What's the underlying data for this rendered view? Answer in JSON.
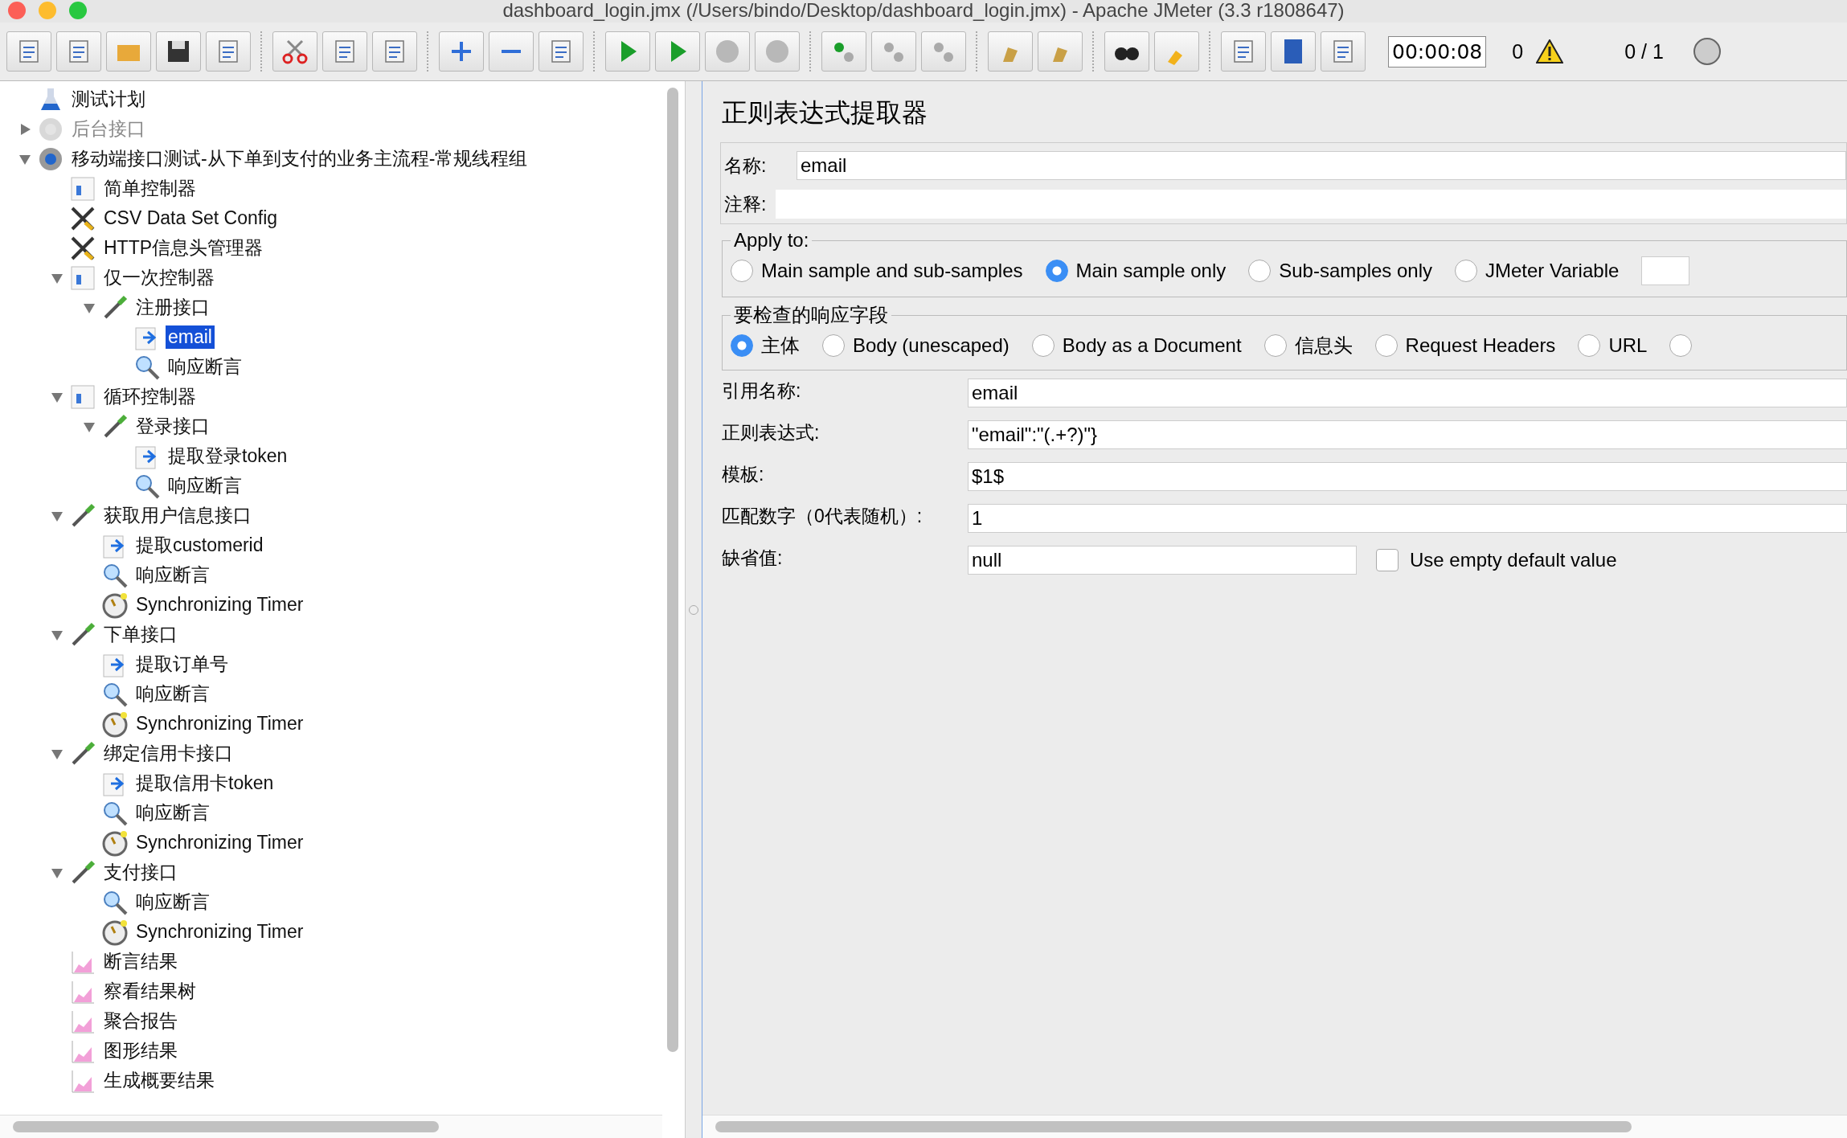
{
  "window": {
    "title": "dashboard_login.jmx (/Users/bindo/Desktop/dashboard_login.jmx) - Apache JMeter (3.3 r1808647)"
  },
  "toolbar": {
    "elapsed": "00:00:08",
    "error_count": "0",
    "threads": "0 / 1"
  },
  "tree": [
    {
      "label": "测试计划",
      "kind": "plan",
      "selected": false,
      "disabled": false
    },
    {
      "label": "后台接口",
      "kind": "thread",
      "selected": false,
      "disabled": true,
      "expanded": false
    },
    {
      "label": "移动端接口测试-从下单到支付的业务主流程-常规线程组",
      "kind": "thread",
      "selected": false,
      "disabled": false,
      "expanded": true,
      "children": [
        {
          "label": "简单控制器",
          "kind": "controller",
          "selected": false,
          "disabled": false
        },
        {
          "label": "CSV Data Set Config",
          "kind": "config",
          "selected": false,
          "disabled": false
        },
        {
          "label": "HTTP信息头管理器",
          "kind": "config",
          "selected": false,
          "disabled": false
        },
        {
          "label": "仅一次控制器",
          "kind": "controller",
          "selected": false,
          "disabled": false,
          "expanded": true,
          "children": [
            {
              "label": "注册接口",
              "kind": "sampler",
              "selected": false,
              "disabled": false,
              "expanded": true,
              "children": [
                {
                  "label": "email",
                  "kind": "extractor",
                  "selected": true,
                  "disabled": false
                },
                {
                  "label": "响应断言",
                  "kind": "assertion",
                  "selected": false,
                  "disabled": false
                }
              ]
            }
          ]
        },
        {
          "label": "循环控制器",
          "kind": "controller",
          "selected": false,
          "disabled": false,
          "expanded": true,
          "children": [
            {
              "label": "登录接口",
              "kind": "sampler",
              "selected": false,
              "disabled": false,
              "expanded": true,
              "children": [
                {
                  "label": "提取登录token",
                  "kind": "extractor",
                  "selected": false,
                  "disabled": false
                },
                {
                  "label": "响应断言",
                  "kind": "assertion",
                  "selected": false,
                  "disabled": false
                }
              ]
            }
          ]
        },
        {
          "label": "获取用户信息接口",
          "kind": "sampler",
          "selected": false,
          "disabled": false,
          "expanded": true,
          "children": [
            {
              "label": "提取customerid",
              "kind": "extractor",
              "selected": false,
              "disabled": false
            },
            {
              "label": "响应断言",
              "kind": "assertion",
              "selected": false,
              "disabled": false
            },
            {
              "label": "Synchronizing Timer",
              "kind": "timer",
              "selected": false,
              "disabled": false
            }
          ]
        },
        {
          "label": "下单接口",
          "kind": "sampler",
          "selected": false,
          "disabled": false,
          "expanded": true,
          "children": [
            {
              "label": "提取订单号",
              "kind": "extractor",
              "selected": false,
              "disabled": false
            },
            {
              "label": "响应断言",
              "kind": "assertion",
              "selected": false,
              "disabled": false
            },
            {
              "label": "Synchronizing Timer",
              "kind": "timer",
              "selected": false,
              "disabled": false
            }
          ]
        },
        {
          "label": "绑定信用卡接口",
          "kind": "sampler",
          "selected": false,
          "disabled": false,
          "expanded": true,
          "children": [
            {
              "label": "提取信用卡token",
              "kind": "extractor",
              "selected": false,
              "disabled": false
            },
            {
              "label": "响应断言",
              "kind": "assertion",
              "selected": false,
              "disabled": false
            },
            {
              "label": "Synchronizing Timer",
              "kind": "timer",
              "selected": false,
              "disabled": false
            }
          ]
        },
        {
          "label": "支付接口",
          "kind": "sampler",
          "selected": false,
          "disabled": false,
          "expanded": true,
          "children": [
            {
              "label": "响应断言",
              "kind": "assertion",
              "selected": false,
              "disabled": false
            },
            {
              "label": "Synchronizing Timer",
              "kind": "timer",
              "selected": false,
              "disabled": false
            }
          ]
        },
        {
          "label": "断言结果",
          "kind": "listener",
          "selected": false,
          "disabled": false
        },
        {
          "label": "察看结果树",
          "kind": "listener",
          "selected": false,
          "disabled": false
        },
        {
          "label": "聚合报告",
          "kind": "listener",
          "selected": false,
          "disabled": false
        },
        {
          "label": "图形结果",
          "kind": "listener",
          "selected": false,
          "disabled": false
        },
        {
          "label": "生成概要结果",
          "kind": "listener",
          "selected": false,
          "disabled": false
        }
      ]
    }
  ],
  "editor": {
    "title": "正则表达式提取器",
    "name": {
      "label": "名称:",
      "value": "email"
    },
    "comment": {
      "label": "注释:"
    },
    "apply_to": {
      "legend": "Apply to:",
      "options": [
        {
          "label": "Main sample and sub-samples",
          "selected": false
        },
        {
          "label": "Main sample only",
          "selected": true
        },
        {
          "label": "Sub-samples only",
          "selected": false
        },
        {
          "label": "JMeter Variable",
          "selected": false
        }
      ]
    },
    "field_to_check": {
      "legend": "要检查的响应字段",
      "options": [
        {
          "label": "主体",
          "selected": true
        },
        {
          "label": "Body (unescaped)",
          "selected": false
        },
        {
          "label": "Body as a Document",
          "selected": false
        },
        {
          "label": "信息头",
          "selected": false
        },
        {
          "label": "Request Headers",
          "selected": false
        },
        {
          "label": "URL",
          "selected": false
        },
        {
          "selected": false
        }
      ]
    },
    "fields": [
      {
        "label": "引用名称:",
        "value": "email"
      },
      {
        "label": "正则表达式:",
        "value": "\"email\":\"(.+?)\"}"
      },
      {
        "label": "模板:",
        "value": "$1$"
      },
      {
        "label": "匹配数字（0代表随机）:",
        "value": "1"
      }
    ],
    "default": {
      "label": "缺省值:",
      "value": "null",
      "use_empty": {
        "label": "Use empty default value",
        "checked": false
      }
    }
  }
}
